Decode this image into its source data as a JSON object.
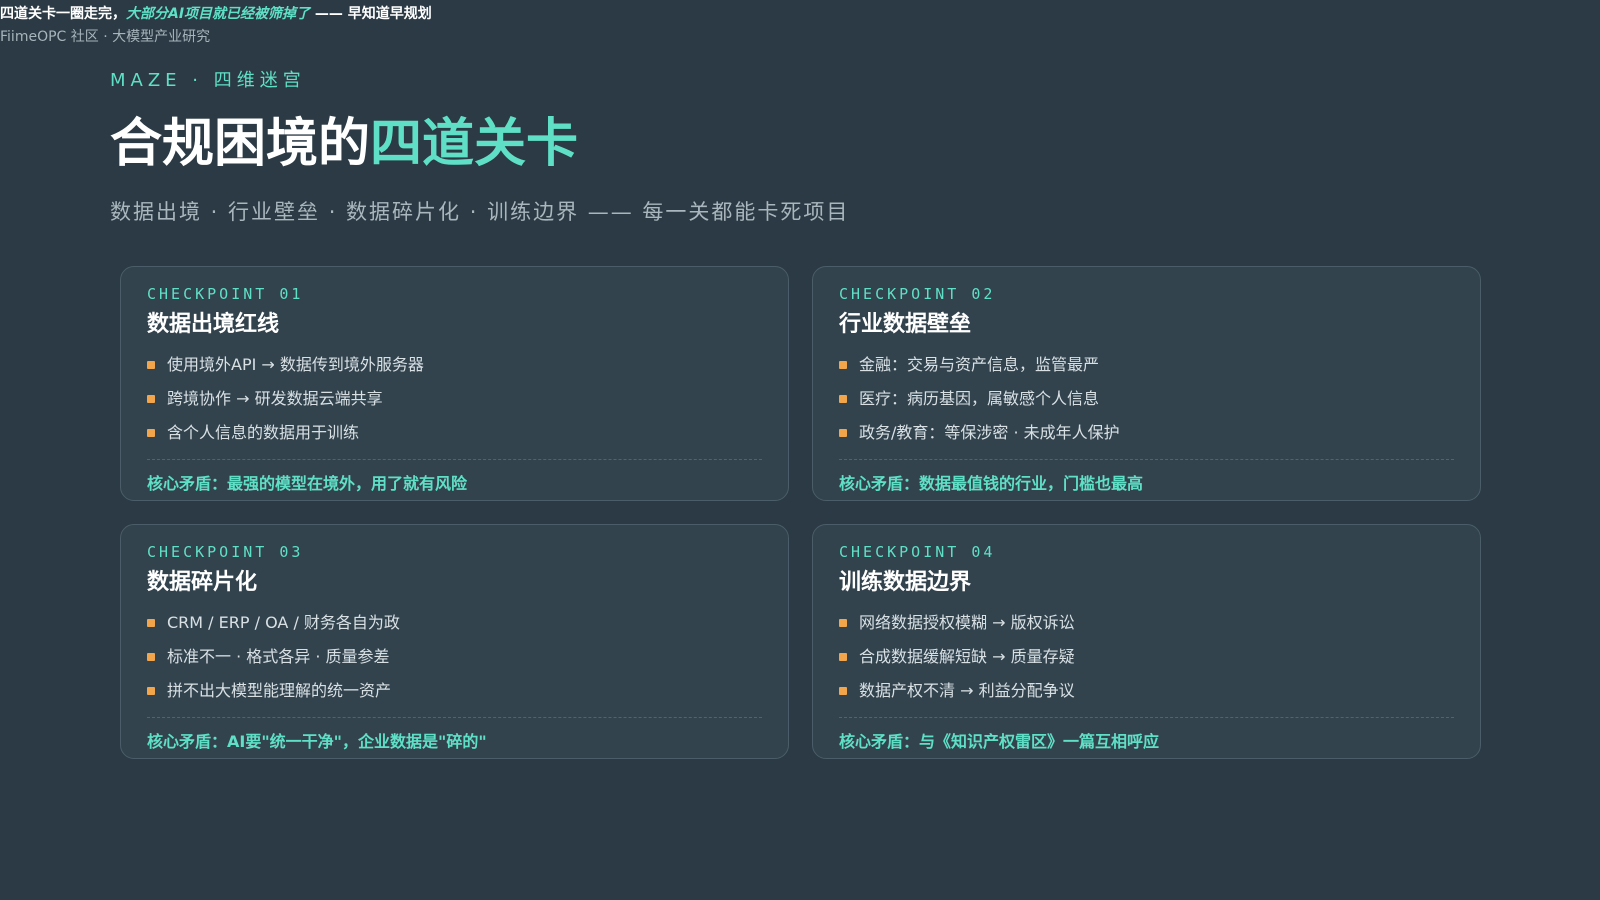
{
  "header": {
    "lead": "四道关卡一圈走完，",
    "highlight": "大部分AI项目就已经被筛掉了",
    "tail": " —— 早知道早规划",
    "source": "FiimeOPC 社区 · 大模型产业研究"
  },
  "eyebrow": "MAZE · 四维迷宫",
  "title": {
    "main": "合规困境的",
    "highlight": "四道关卡"
  },
  "subtitle": "数据出境 · 行业壁垒 · 数据碎片化 · 训练边界 —— 每一关都能卡死项目",
  "cards": [
    {
      "checkpoint": "CHECKPOINT 01",
      "title": "数据出境红线",
      "bullets": [
        "使用境外API → 数据传到境外服务器",
        "跨境协作 → 研发数据云端共享",
        "含个人信息的数据用于训练"
      ],
      "core": "核心矛盾：最强的模型在境外，用了就有风险"
    },
    {
      "checkpoint": "CHECKPOINT 02",
      "title": "行业数据壁垒",
      "bullets": [
        "金融：交易与资产信息，监管最严",
        "医疗：病历基因，属敏感个人信息",
        "政务/教育：等保涉密 · 未成年人保护"
      ],
      "core": "核心矛盾：数据最值钱的行业，门槛也最高"
    },
    {
      "checkpoint": "CHECKPOINT 03",
      "title": "数据碎片化",
      "bullets": [
        "CRM / ERP / OA / 财务各自为政",
        "标准不一 · 格式各异 · 质量参差",
        "拼不出大模型能理解的统一资产"
      ],
      "core": "核心矛盾：AI要\"统一干净\"，企业数据是\"碎的\""
    },
    {
      "checkpoint": "CHECKPOINT 04",
      "title": "训练数据边界",
      "bullets": [
        "网络数据授权模糊 → 版权诉讼",
        "合成数据缓解短缺 → 质量存疑",
        "数据产权不清 → 利益分配争议"
      ],
      "core": "核心矛盾：与《知识产权雷区》一篇互相呼应"
    }
  ],
  "colors": {
    "background": "#2b3a44",
    "accent": "#5fe0c6",
    "bullet": "#f2a54a"
  }
}
